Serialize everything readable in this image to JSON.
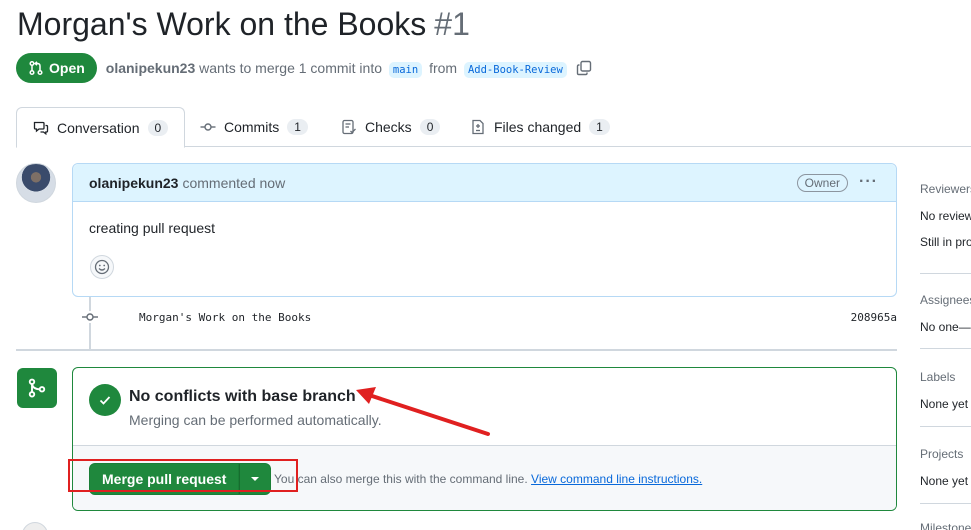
{
  "pr": {
    "title": "Morgan's Work on the Books",
    "number": "#1",
    "state": "Open",
    "author": "olanipekun23",
    "meta_text": "wants to merge 1 commit into",
    "base_branch": "main",
    "from_text": "from",
    "head_branch": "Add-Book-Review"
  },
  "tabs": [
    {
      "label": "Conversation",
      "count": "0"
    },
    {
      "label": "Commits",
      "count": "1"
    },
    {
      "label": "Checks",
      "count": "0"
    },
    {
      "label": "Files changed",
      "count": "1"
    }
  ],
  "comment": {
    "author": "olanipekun23",
    "action": "commented now",
    "role": "Owner",
    "body": "creating pull request"
  },
  "commit": {
    "message": "Morgan's Work on the Books",
    "sha": "208965a"
  },
  "merge": {
    "title": "No conflicts with base branch",
    "subtitle": "Merging can be performed automatically.",
    "button": "Merge pull request",
    "hint": "You can also merge this with the command line.",
    "link": "View command line instructions."
  },
  "sidebar": {
    "reviewers_head": "Reviewers",
    "reviewers_val": "No reviews",
    "reviewers_val2": "Still in progress",
    "assignees_head": "Assignees",
    "assignees_val": "No one—",
    "labels_head": "Labels",
    "labels_val": "None yet",
    "projects_head": "Projects",
    "projects_val": "None yet",
    "milestone_head": "Milestone"
  },
  "colors": {
    "green": "#1f883d",
    "link": "#0969da",
    "annotation_red": "#e02020"
  }
}
